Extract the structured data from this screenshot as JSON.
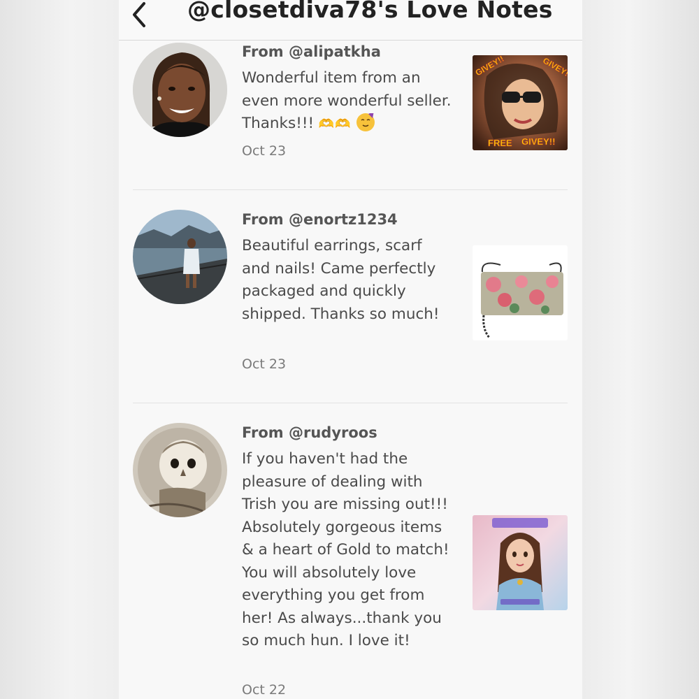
{
  "header": {
    "title": "@closetdiva78's Love Notes",
    "back_icon": "chevron-left-icon"
  },
  "notes": [
    {
      "from": "From @alipatkha",
      "message": "Wonderful item from an even more wonderful seller. Thanks!!!",
      "emoji_hands": "🫶🫶",
      "date": "Oct 23",
      "thumb_text_1": "GIVEY!!",
      "thumb_text_2": "GIVEY!!",
      "thumb_text_3": "FREE",
      "thumb_text_4": "GIVEY!!"
    },
    {
      "from": "From @enortz1234",
      "message": "Beautiful earrings, scarf and nails! Came perfectly packaged and quickly shipped. Thanks so much!",
      "date": "Oct 23"
    },
    {
      "from": "From @rudyroos",
      "message": "If you haven't had the pleasure of dealing with Trish you are missing out!!! Absolutely gorgeous items & a heart of Gold to match! You will absolutely love everything you get from her! As always...thank you so much hun. I love it!",
      "date": "Oct 22"
    }
  ]
}
